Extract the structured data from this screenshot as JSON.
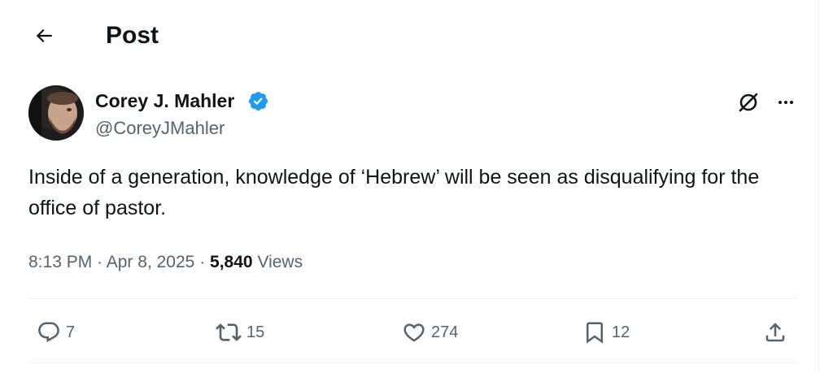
{
  "header": {
    "title": "Post"
  },
  "author": {
    "name": "Corey J. Mahler",
    "handle": "@CoreyJMahler",
    "verified": true
  },
  "tweet": {
    "text": "Inside of a generation, knowledge of ‘Hebrew’ will be seen as disqualifying for the office of pastor."
  },
  "meta": {
    "time": "8:13 PM",
    "separator": "·",
    "date": "Apr 8, 2025",
    "views_count": "5,840",
    "views_label": "Views"
  },
  "actions": {
    "replies": "7",
    "reposts": "15",
    "likes": "274",
    "bookmarks": "12"
  },
  "icons": [
    "back-arrow-icon",
    "verified-badge-icon",
    "grok-icon",
    "more-icon",
    "reply-icon",
    "repost-icon",
    "like-icon",
    "bookmark-icon",
    "share-icon"
  ],
  "colors": {
    "verified": "#1d9bf0",
    "text": "#0f1419",
    "secondary": "#536471",
    "divider": "#eff3f4"
  }
}
